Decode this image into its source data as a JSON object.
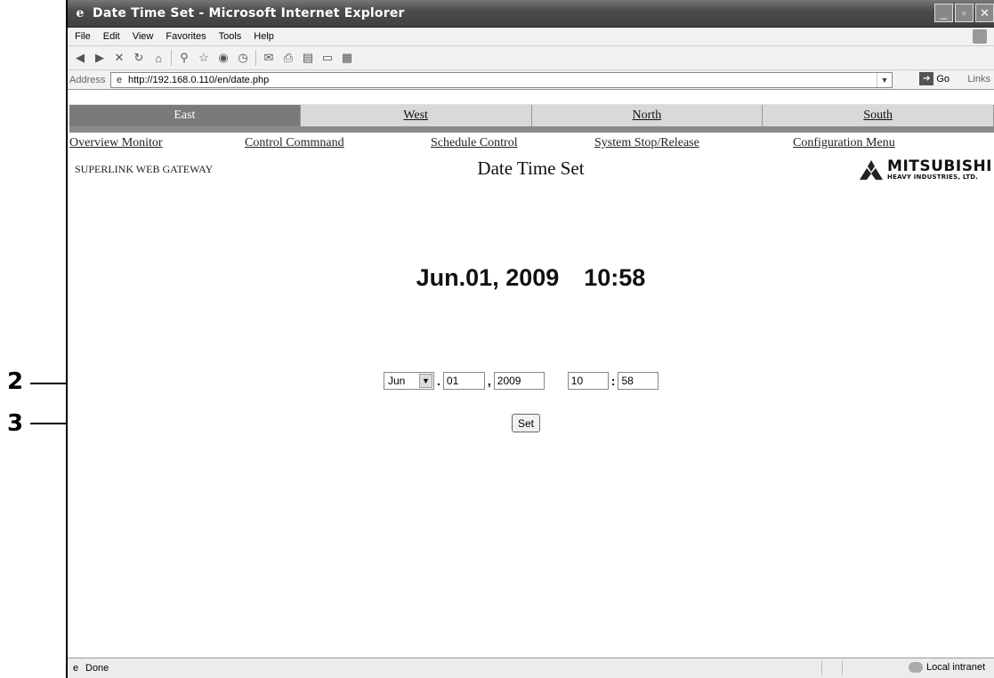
{
  "callouts": {
    "first": "2",
    "second": "3"
  },
  "window": {
    "title": "Date Time Set - Microsoft Internet Explorer",
    "menu": [
      "File",
      "Edit",
      "View",
      "Favorites",
      "Tools",
      "Help"
    ],
    "address_label": "Address",
    "url": "http://192.168.0.110/en/date.php",
    "go_label": "Go",
    "links_label": "Links"
  },
  "tabs": [
    "East",
    "West",
    "North",
    "South"
  ],
  "nav": [
    "Overview Monitor",
    "Control Commnand",
    "Schedule Control",
    "System Stop/Release",
    "Configuration Menu"
  ],
  "header": {
    "left": "SUPERLINK WEB GATEWAY",
    "title": "Date Time Set",
    "logo_big": "MITSUBISHI",
    "logo_small": "HEAVY INDUSTRIES, LTD."
  },
  "current": {
    "date": "Jun.01, 2009",
    "time": "10:58"
  },
  "form": {
    "month": "Jun",
    "sep_dot": ".",
    "day": "01",
    "sep_comma": ",",
    "year": "2009",
    "hour": "10",
    "sep_colon": ":",
    "minute": "58",
    "set_label": "Set"
  },
  "status": {
    "left": "Done",
    "zone": "Local intranet"
  }
}
